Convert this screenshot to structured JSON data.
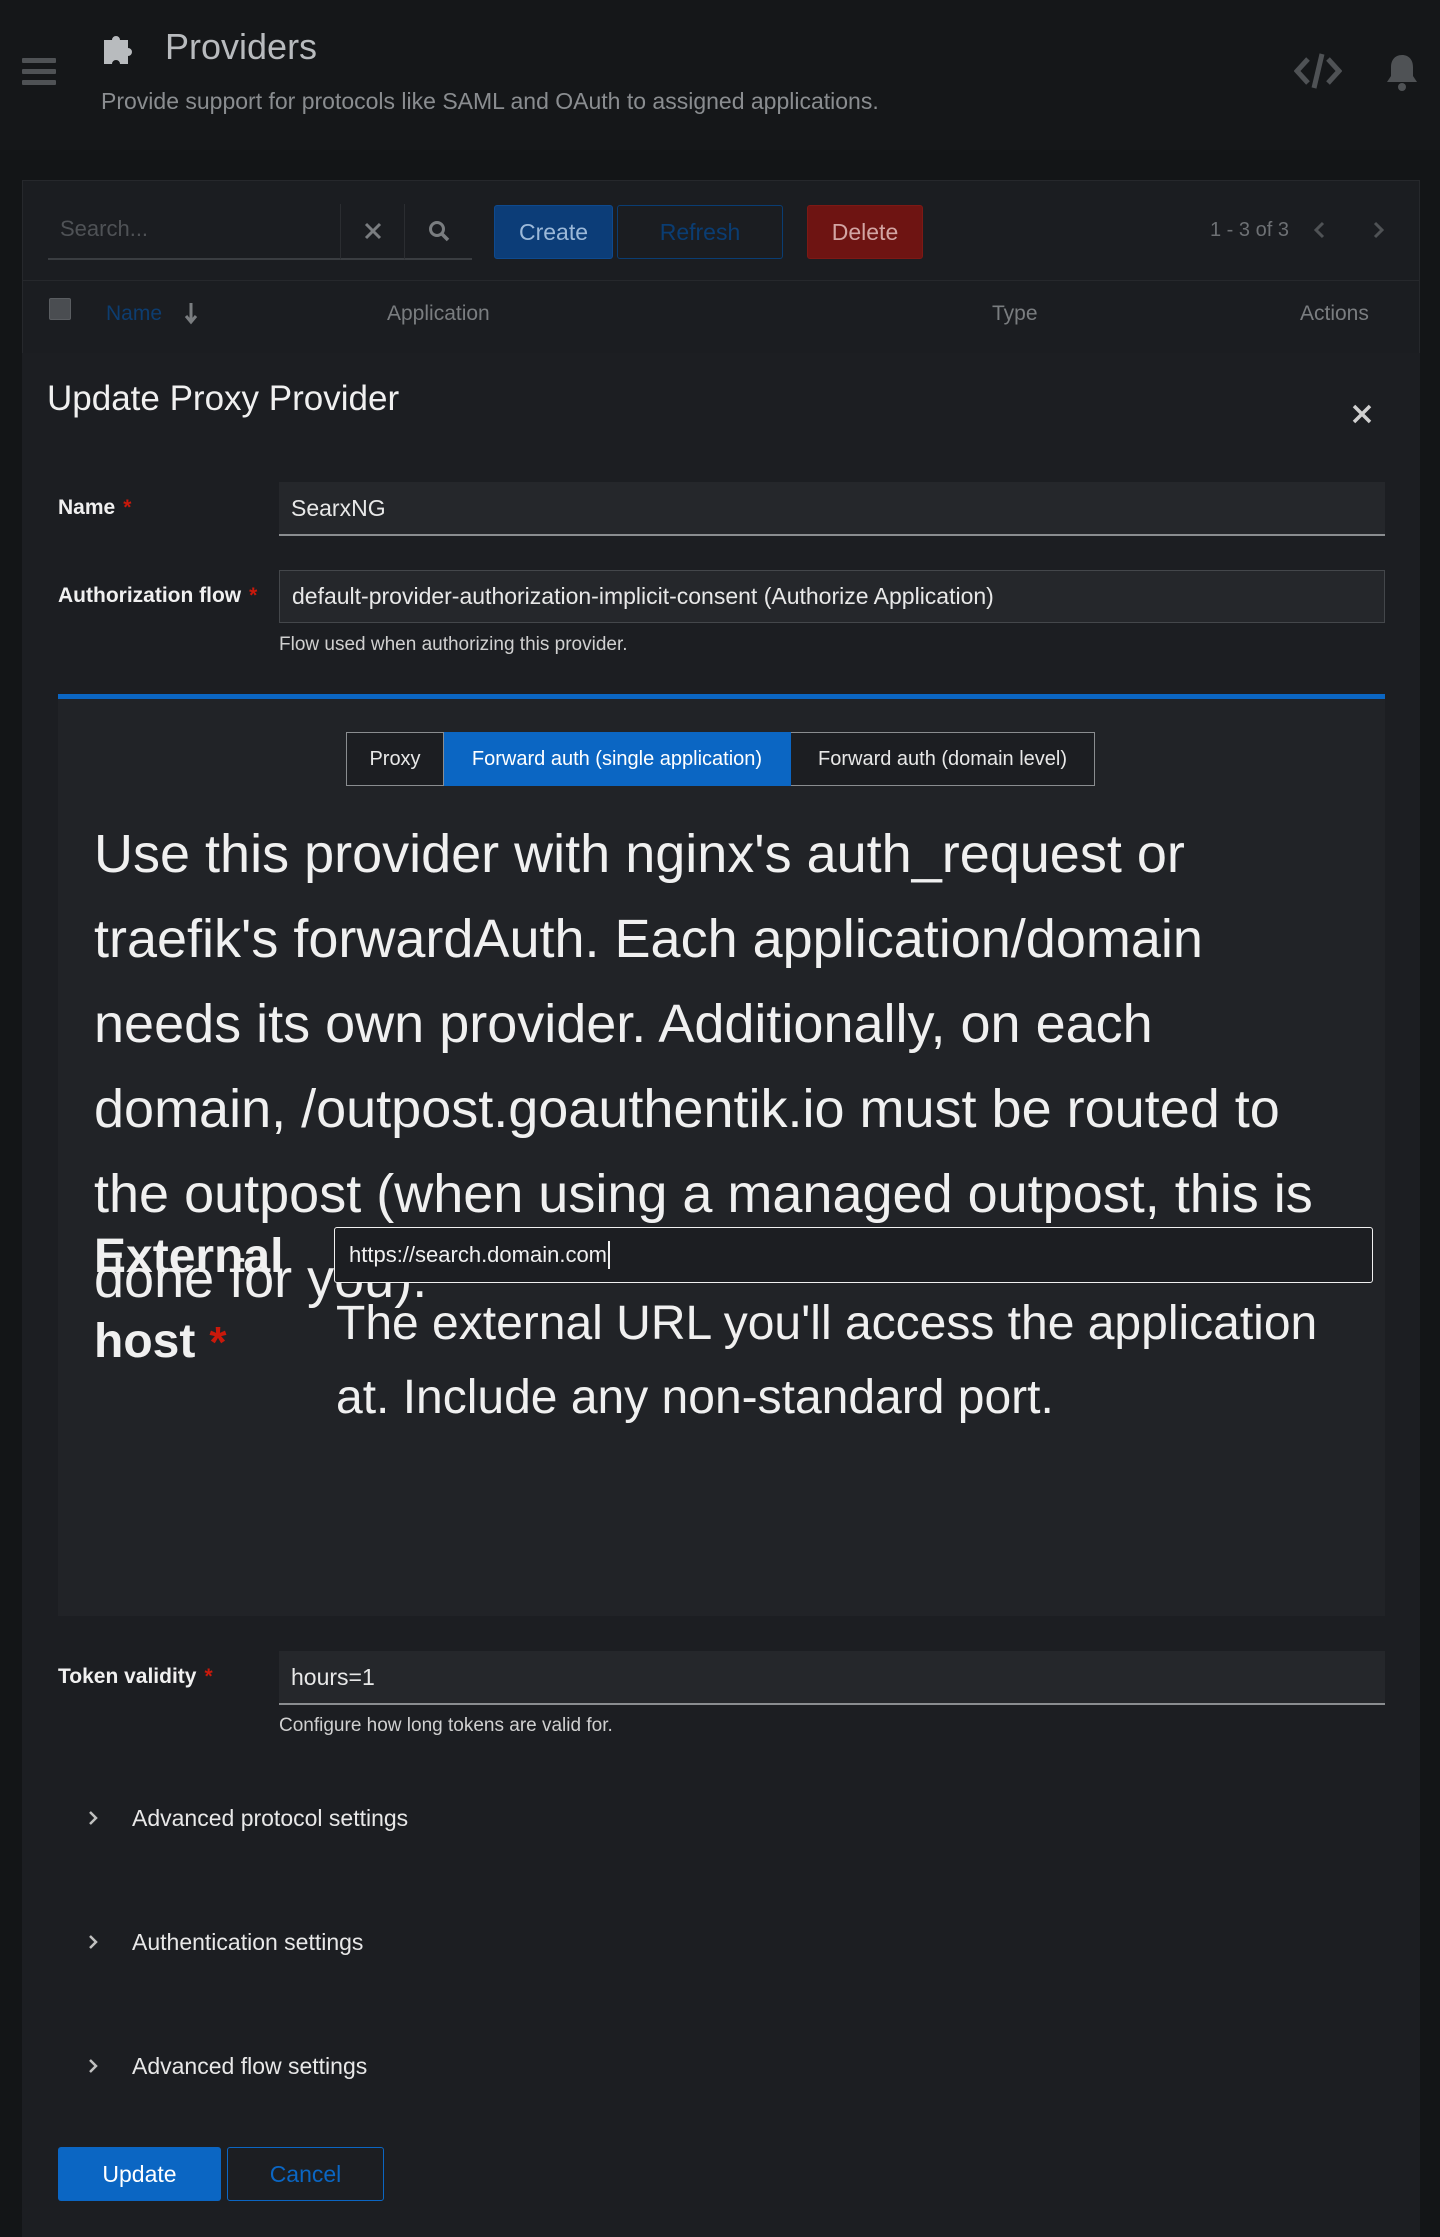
{
  "header": {
    "title": "Providers",
    "description": "Provide support for protocols like SAML and OAuth to assigned applications."
  },
  "toolbar": {
    "search_placeholder": "Search...",
    "create_label": "Create",
    "refresh_label": "Refresh",
    "delete_label": "Delete",
    "pagination": "1 - 3 of 3"
  },
  "table": {
    "columns": [
      "Name",
      "Application",
      "Type",
      "Actions"
    ]
  },
  "modal": {
    "title": "Update Proxy Provider",
    "name": {
      "label": "Name",
      "value": "SearxNG"
    },
    "auth_flow": {
      "label": "Authorization flow",
      "value": "default-provider-authorization-implicit-consent (Authorize Application)",
      "helper": "Flow used when authorizing this provider."
    },
    "mode": {
      "options": [
        "Proxy",
        "Forward auth (single application)",
        "Forward auth (domain level)"
      ],
      "selected": "Forward auth (single application)",
      "description": "Use this provider with nginx's auth_request or traefik's forwardAuth. Each application/domain needs its own provider. Additionally, on each domain, /outpost.goauthentik.io must be routed to the outpost (when using a managed outpost, this is done for you)."
    },
    "external_host": {
      "label": "External host",
      "value": "https://search.domain.com",
      "helper": "The external URL you'll access the application at. Include any non-standard port."
    },
    "token_validity": {
      "label": "Token validity",
      "value": "hours=1",
      "helper": "Configure how long tokens are valid for."
    },
    "sections": [
      "Advanced protocol settings",
      "Authentication settings",
      "Advanced flow settings"
    ],
    "update_label": "Update",
    "cancel_label": "Cancel",
    "required_marker": "*"
  },
  "colors": {
    "primary": "#0b66c3",
    "danger": "#c9190b",
    "background": "#131517",
    "modal": "#1c1e22"
  }
}
